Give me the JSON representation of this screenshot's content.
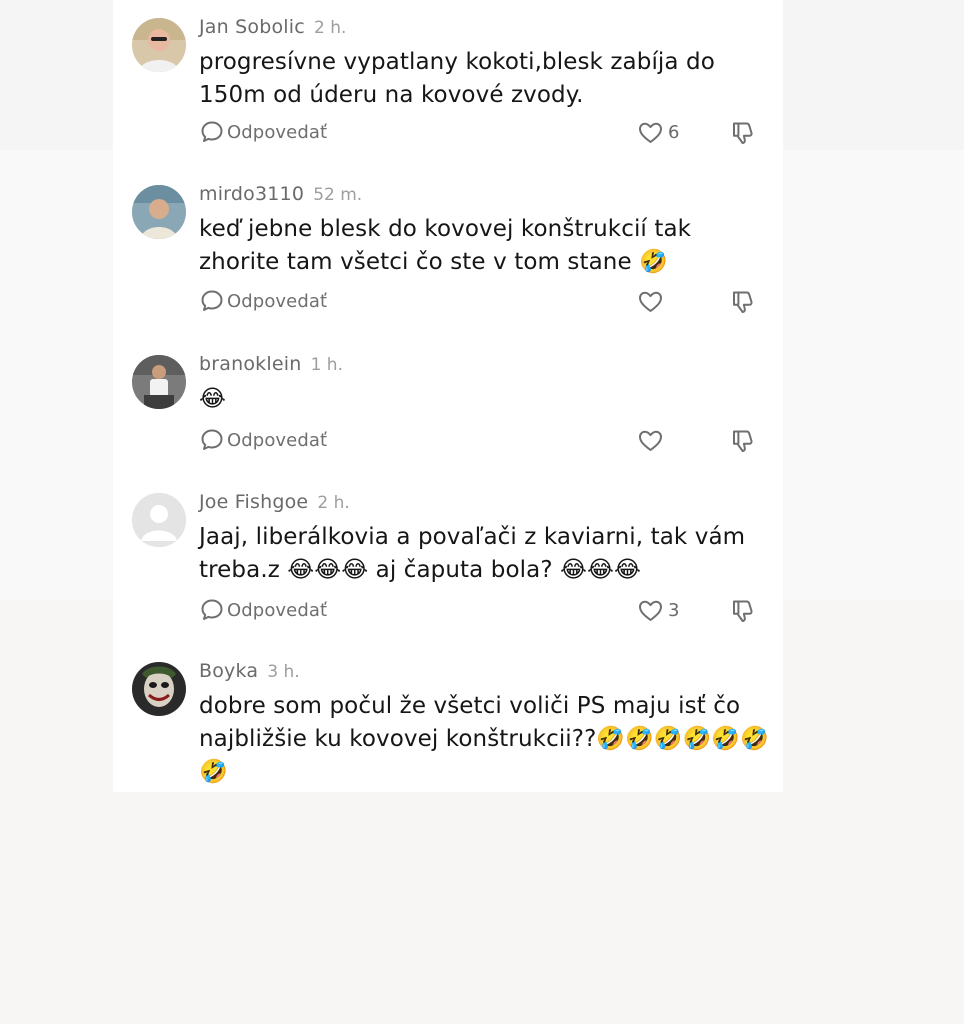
{
  "ui": {
    "reply_label": "Odpovedať",
    "icons": {
      "reply": "speech-bubble-icon",
      "like": "heart-icon",
      "dislike": "thumbs-down-icon"
    },
    "colors": {
      "text": "#161616",
      "meta": "#6a6a6a",
      "time": "#9e9e9e",
      "panel": "#ffffff",
      "background": "#f7f6f4"
    }
  },
  "comments": [
    {
      "username": "Jan Sobolic",
      "time": "2 h.",
      "text": "progresívne vypatlany kokoti,blesk zabíja do 150m od úderu na kovové zvody.",
      "likes": "6"
    },
    {
      "username": "mirdo3110",
      "time": "52 m.",
      "text": "keď jebne blesk do kovovej konštrukcií tak zhorite tam všetci čo ste v tom stane 🤣",
      "likes": ""
    },
    {
      "username": "branoklein",
      "time": "1 h.",
      "text": "😂",
      "likes": ""
    },
    {
      "username": "Joe Fishgoe",
      "time": "2 h.",
      "text": "Jaaj, liberálkovia a povaľači z kaviarni, tak vám treba.z 😂😂😂 aj čaputa bola? 😂😂😂",
      "likes": "3"
    },
    {
      "username": "Boyka",
      "time": "3 h.",
      "text": "dobre som počul že všetci voliči PS maju isť čo najbližšie ku kovovej konštrukcii??🤣🤣🤣🤣🤣🤣🤣",
      "likes": ""
    }
  ]
}
